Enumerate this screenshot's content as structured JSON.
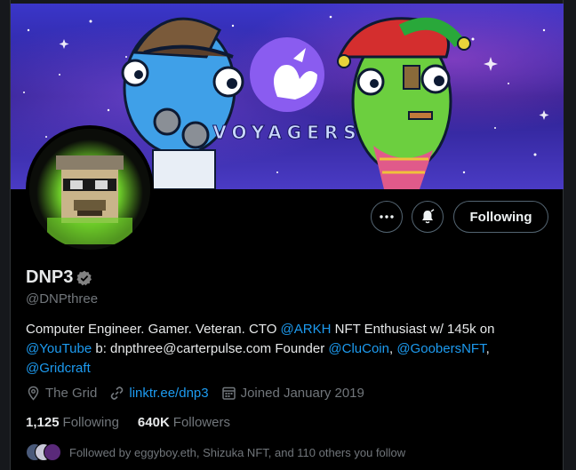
{
  "banner": {
    "text": "VOYAGERS"
  },
  "profile": {
    "display_name": "DNP3",
    "handle": "@DNPthree",
    "bio": {
      "t1": "Computer Engineer. Gamer. Veteran. CTO ",
      "m1": "@ARKH",
      "t2": " NFT Enthusiast w/ 145k on ",
      "m2": "@YouTube",
      "t3": " b: dnpthree@carterpulse.com Founder ",
      "m3": "@CluCoin",
      "t4": ", ",
      "m4": "@GoobersNFT",
      "t5": ", ",
      "m5": "@Gridcraft"
    },
    "location": "The Grid",
    "link": "linktr.ee/dnp3",
    "joined": "Joined January 2019",
    "following_count": "1,125",
    "following_label": "Following",
    "followers_count": "640K",
    "followers_label": "Followers",
    "followed_by": "Followed by eggyboy.eth, Shizuka NFT, and 110 others you follow"
  },
  "actions": {
    "follow_label": "Following",
    "more_icon": "more-horizontal-icon",
    "notify_icon": "bell-subscribed-icon"
  },
  "colors": {
    "background": "#000000",
    "link": "#1d9bf0",
    "muted": "#71767b",
    "text": "#e7e9ea"
  }
}
